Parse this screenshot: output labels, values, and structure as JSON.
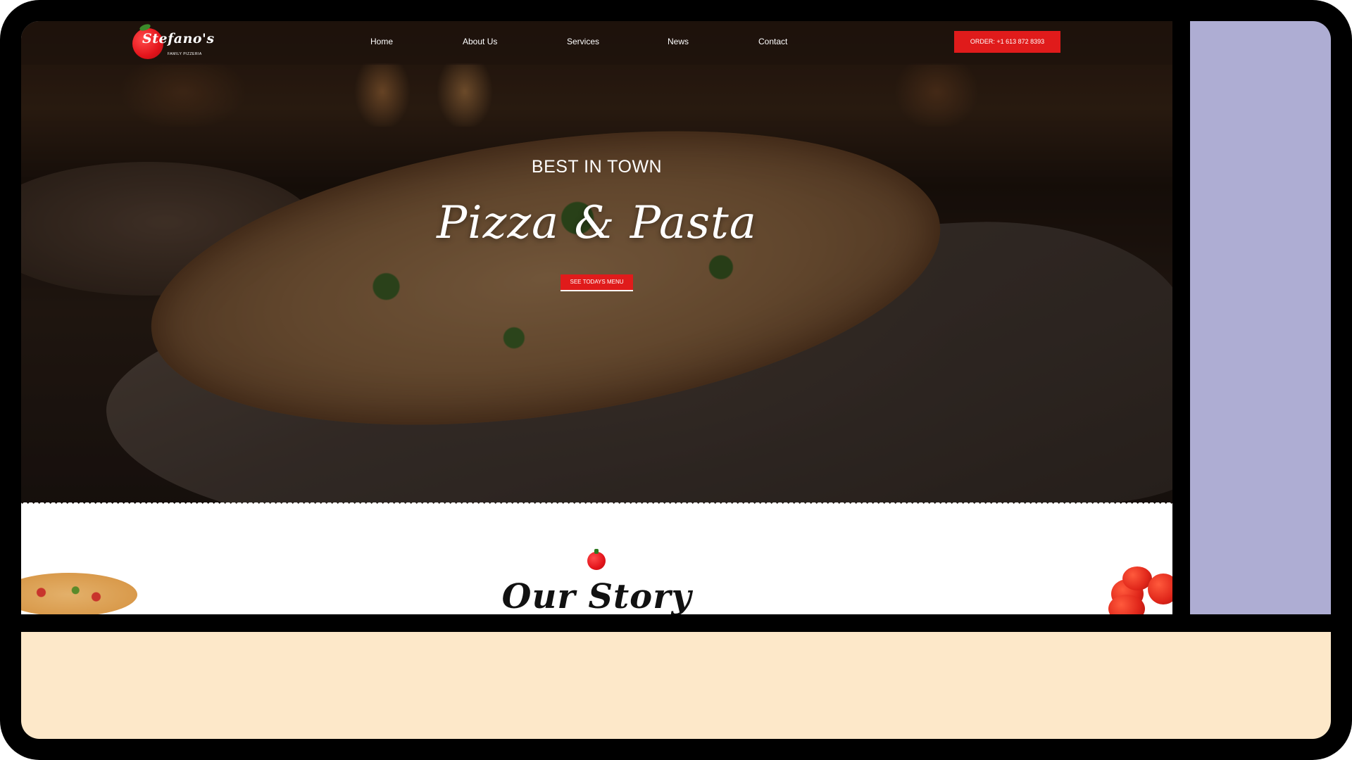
{
  "logo": {
    "name": "Stefano's",
    "tagline": "FAMILY PIZZERIA"
  },
  "nav": {
    "items": [
      {
        "label": "Home"
      },
      {
        "label": "About Us"
      },
      {
        "label": "Services"
      },
      {
        "label": "News"
      },
      {
        "label": "Contact"
      }
    ],
    "order_button": "ORDER: +1 613 872 8393"
  },
  "hero": {
    "kicker": "BEST IN TOWN",
    "title": "Pizza & Pasta",
    "cta": "SEE TODAYS MENU"
  },
  "story": {
    "heading": "Our Story"
  },
  "colors": {
    "accent_red": "#e01b1b",
    "side_panel": "#aeadd3",
    "bottom_panel": "#fde8c9",
    "frame": "#000000"
  }
}
